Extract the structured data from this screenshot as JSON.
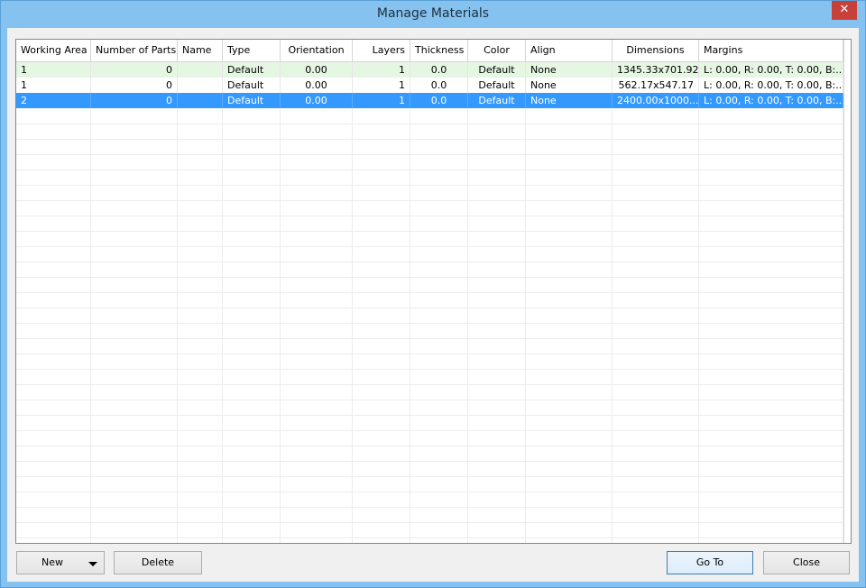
{
  "window": {
    "title": "Manage Materials",
    "close_glyph": "✕"
  },
  "table": {
    "columns": [
      "Working Area",
      "Number of Parts",
      "Name",
      "Type",
      "Orientation",
      "Layers",
      "Thickness",
      "Color",
      "Align",
      "Dimensions",
      "Margins"
    ],
    "rows": [
      [
        "1",
        "0",
        "",
        "Default",
        "0.00",
        "1",
        "0.0",
        "Default",
        "None",
        "1345.33x701.92",
        "L: 0.00, R: 0.00, T: 0.00, B:..."
      ],
      [
        "1",
        "0",
        "",
        "Default",
        "0.00",
        "1",
        "0.0",
        "Default",
        "None",
        "562.17x547.17",
        "L: 0.00, R: 0.00, T: 0.00, B:..."
      ],
      [
        "2",
        "0",
        "",
        "Default",
        "0.00",
        "1",
        "0.0",
        "Default",
        "None",
        "2400.00x1000...",
        "L: 0.00, R: 0.00, T: 0.00, B:..."
      ]
    ],
    "selected_row": 2,
    "colors": {
      "selected": "#3399ff",
      "alt_row": "#e5f7e3"
    }
  },
  "buttons": {
    "new": "New",
    "delete": "Delete",
    "goto": "Go To",
    "close": "Close"
  }
}
